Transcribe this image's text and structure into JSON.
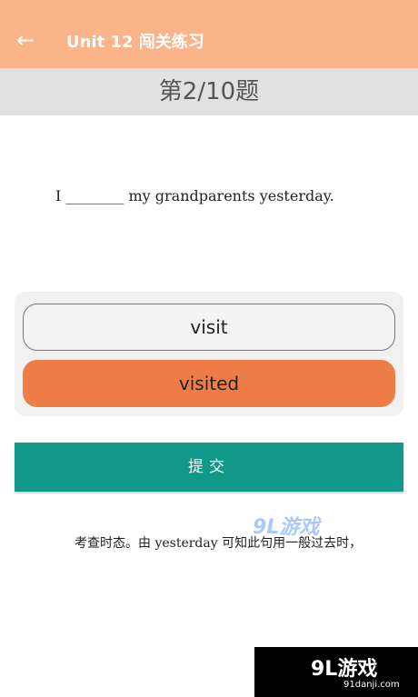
{
  "header": {
    "back_icon": "arrow-left-icon",
    "back_glyph": "←",
    "title": "Unit 12 闯关练习"
  },
  "progress": {
    "label": "第2/10题"
  },
  "question": {
    "text": "I ________ my grandparents yesterday."
  },
  "options": [
    {
      "label": "visit",
      "selected": false
    },
    {
      "label": "visited",
      "selected": true
    }
  ],
  "submit": {
    "label": "提交"
  },
  "explanation": {
    "text": "考查时态。由 yesterday 可知此句用一般过去时，"
  },
  "watermark": {
    "mid_text": "9L游戏",
    "corner_logo": "9L游戏",
    "corner_url": "91danji.com"
  },
  "colors": {
    "header_bg": "#fbb38a",
    "progress_bg": "#e1e1e1",
    "selected_option": "#ee7d48",
    "submit_bg": "#12998a"
  }
}
